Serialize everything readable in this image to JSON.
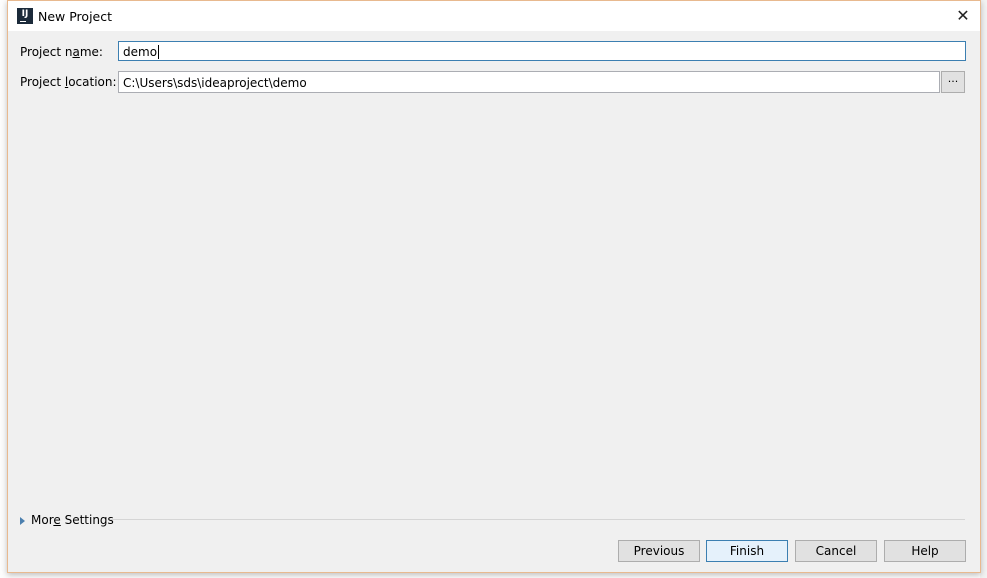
{
  "dialog": {
    "title": "New Project",
    "app_icon": "intellij-idea-icon",
    "close_icon": "close-icon"
  },
  "form": {
    "name_label_pre": "Project n",
    "name_label_u": "a",
    "name_label_post": "me:",
    "name_value": "demo",
    "location_label_pre": "Project ",
    "location_label_u": "l",
    "location_label_post": "ocation:",
    "location_value": "C:\\Users\\sds\\ideaproject\\demo",
    "browse_label": "..."
  },
  "more_settings": {
    "pre": "Mor",
    "u": "e",
    "post": " Settings"
  },
  "buttons": {
    "previous": "Previous",
    "finish": "Finish",
    "cancel": "Cancel",
    "help": "Help"
  }
}
